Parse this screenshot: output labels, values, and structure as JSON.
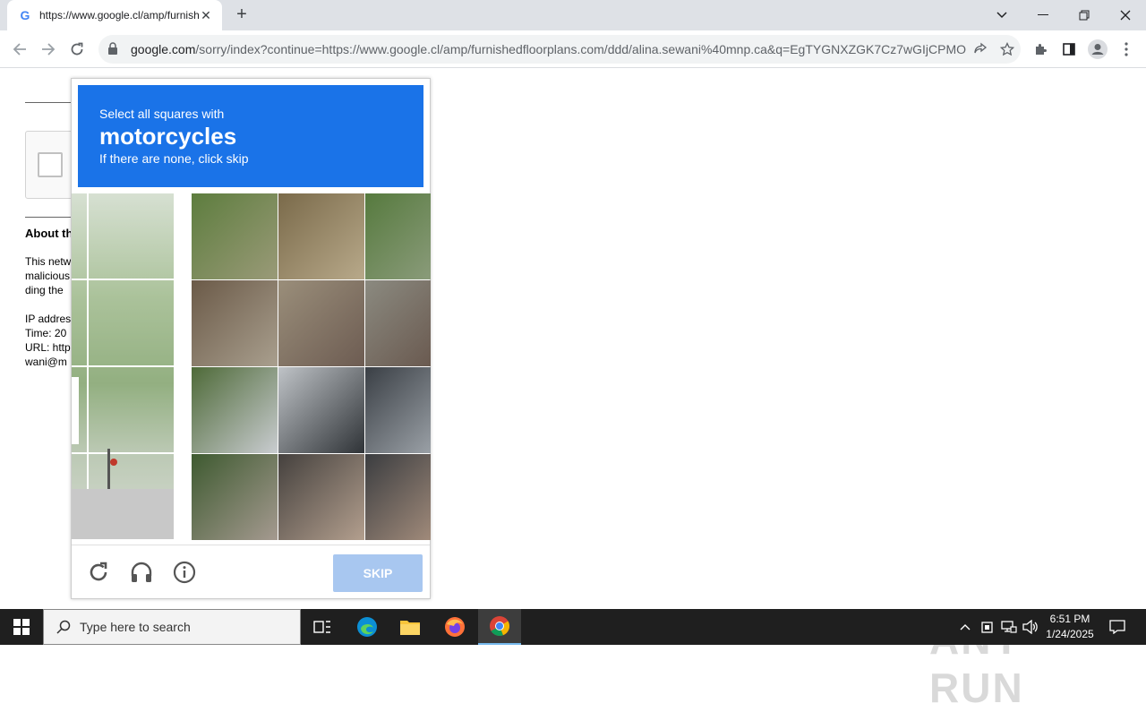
{
  "browser": {
    "tab_title": "https://www.google.cl/amp/furnishedfloorplans.com",
    "new_tab_symbol": "+",
    "close_tab_symbol": "✕",
    "url_domain": "google.com",
    "url_path": "/sorry/index?continue=https://www.google.cl/amp/furnishedfloorplans.com/ddd/alina.sewani%40mnp.ca&q=EgTYGNXZGK7Cz7wGIjCPMO..."
  },
  "background_page": {
    "heading": "About th",
    "para_lines": [
      "This netw",
      "malicious",
      "ding the"
    ],
    "info_lines": [
      "IP addres",
      "Time: 20",
      "URL: http",
      "wani@m"
    ]
  },
  "captcha": {
    "instruction": "Select all squares with",
    "target": "motorcycles",
    "hint": "If there are none, click skip",
    "skip_label": "SKIP",
    "colors": {
      "header": "#1a73e8",
      "skip": "#a8c7f0"
    }
  },
  "taskbar": {
    "search_placeholder": "Type here to search",
    "time": "6:51 PM",
    "date": "1/24/2025"
  },
  "watermark": "ANY RUN"
}
